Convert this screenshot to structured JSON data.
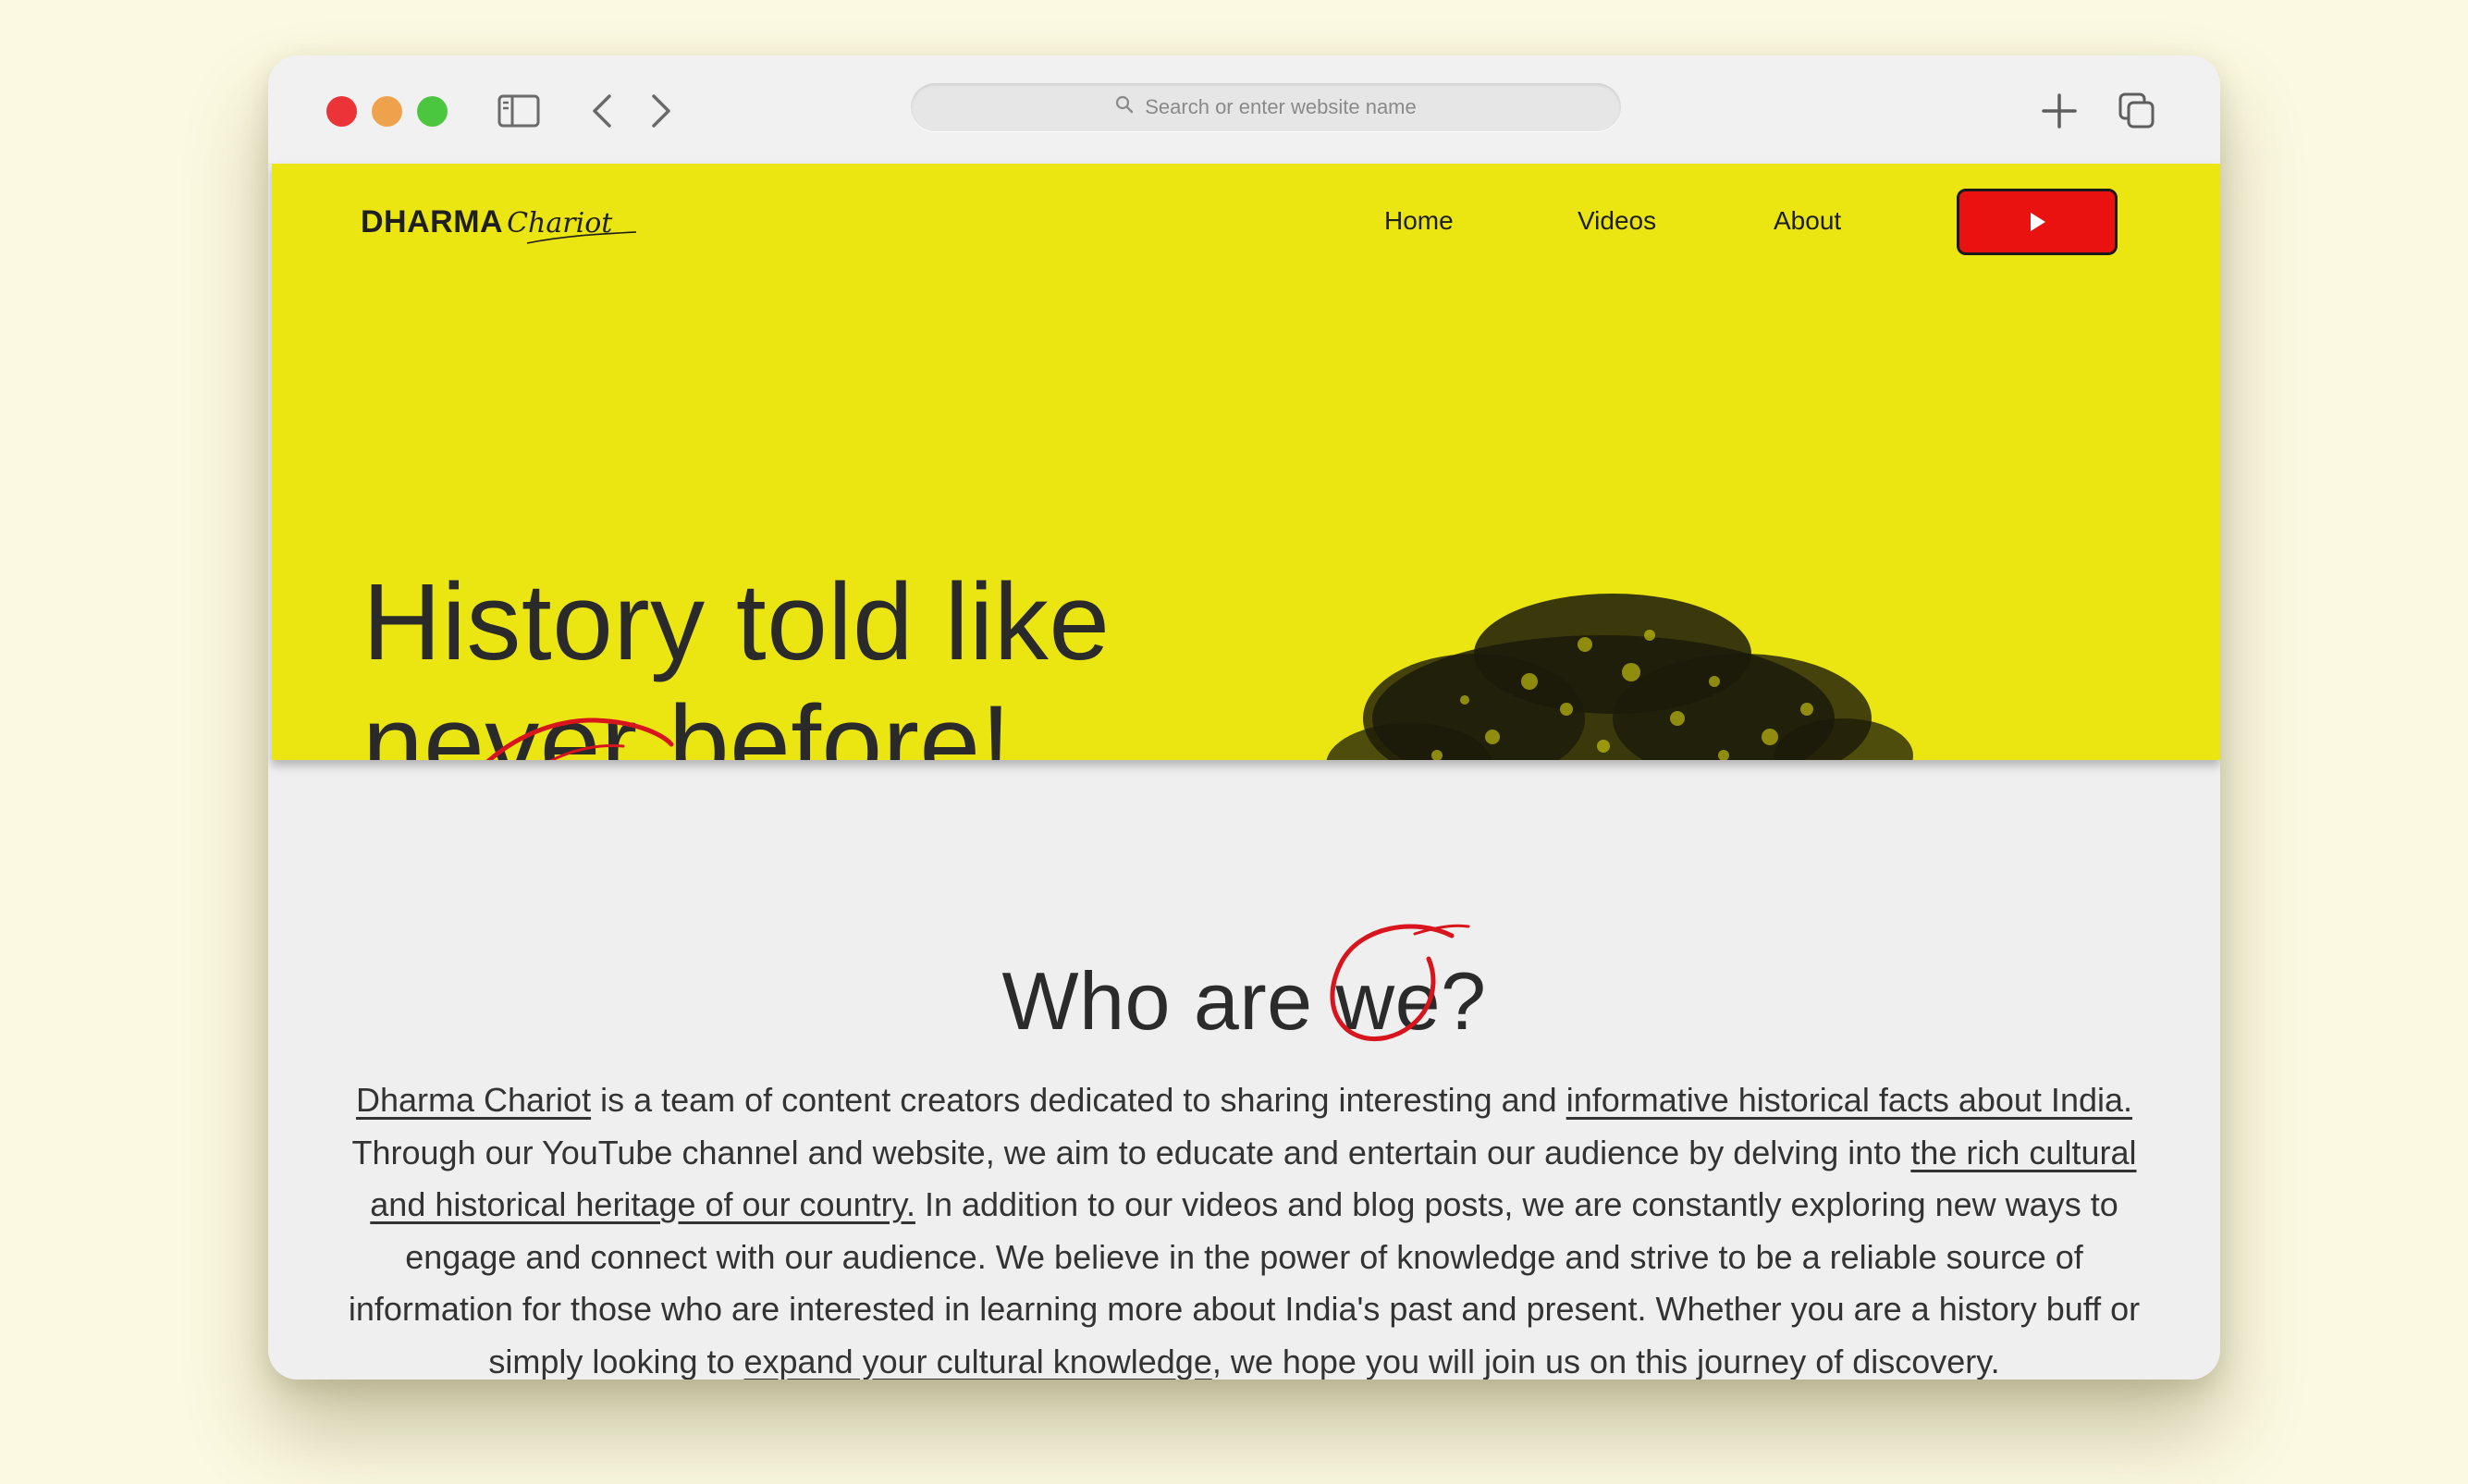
{
  "browser": {
    "url_placeholder": "Search or enter website name",
    "icons": {
      "sidebar": "sidebar-icon",
      "back": "chevron-left-icon",
      "forward": "chevron-right-icon",
      "search": "search-icon",
      "new_tab": "plus-icon",
      "tabs": "tabs-icon"
    }
  },
  "site": {
    "logo": {
      "main": "DHARMA",
      "script": "Chariot"
    },
    "nav": [
      {
        "label": "Home"
      },
      {
        "label": "Videos"
      },
      {
        "label": "About"
      }
    ],
    "cta_icon": "play-icon",
    "hero": {
      "line1": "History told like",
      "line2": "never before!"
    },
    "about": {
      "title": "Who are we?",
      "p1_link": "Dharma Chariot",
      "p2": " is a team of content creators dedicated to sharing interesting and ",
      "p3_link": "informative historical facts about India.",
      "p4": " Through our YouTube channel and website, we aim to educate and entertain our audience by delving into ",
      "p5_link": "the rich cultural and historical heritage of our country.",
      "p6": " In addition to our videos and blog posts, we are constantly exploring new ways to engage and connect with our audience. We believe in the power of knowledge and strive to be a reliable source of information for those who are interested in learning more about India's past and present. Whether you are a history buff or simply looking to ",
      "p7_link": "expand your cultural knowledge",
      "p8": ", we hope you will join us on this journey of discovery."
    }
  },
  "colors": {
    "hero_bg": "#ebe612",
    "cta_red": "#ea1211",
    "accent_scribble": "#d8141c"
  }
}
